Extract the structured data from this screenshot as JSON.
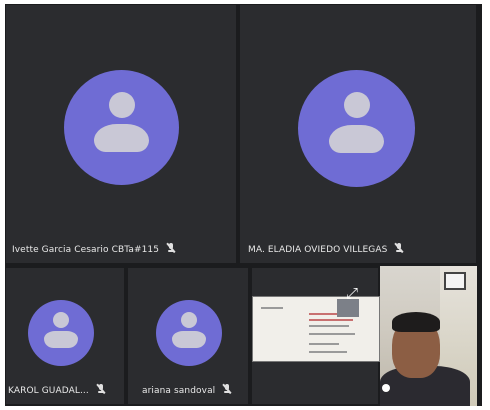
{
  "participants": [
    {
      "name": "Ivette Garcia Cesario CBTa#115",
      "muted": true
    },
    {
      "name": "MA. ELADIA OVIEDO VILLEGAS",
      "muted": true
    },
    {
      "name": "KAROL GUADAL...",
      "muted": true
    },
    {
      "name": "ariana sandoval",
      "muted": true
    }
  ],
  "icons": {
    "mic_off": "mic-off-icon",
    "avatar": "person-avatar-icon",
    "expand": "expand-icon",
    "pin": "pin-frame-icon"
  },
  "colors": {
    "background": "#1b1c1e",
    "tile": "#2b2c2f",
    "avatar": "#6f6cd4",
    "avatar_glyph": "#c9c8d6",
    "text": "#e8e8e8"
  }
}
